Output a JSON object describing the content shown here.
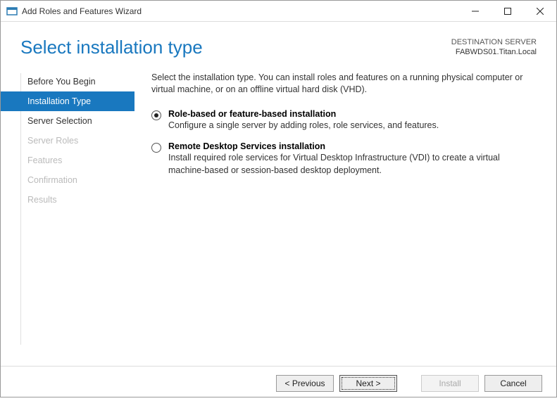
{
  "window": {
    "title": "Add Roles and Features Wizard"
  },
  "header": {
    "page_title": "Select installation type",
    "destination_label": "DESTINATION SERVER",
    "destination_value": "FABWDS01.Titan.Local"
  },
  "sidebar": {
    "items": [
      {
        "label": "Before You Begin",
        "state": "normal"
      },
      {
        "label": "Installation Type",
        "state": "active"
      },
      {
        "label": "Server Selection",
        "state": "normal"
      },
      {
        "label": "Server Roles",
        "state": "disabled"
      },
      {
        "label": "Features",
        "state": "disabled"
      },
      {
        "label": "Confirmation",
        "state": "disabled"
      },
      {
        "label": "Results",
        "state": "disabled"
      }
    ]
  },
  "content": {
    "intro": "Select the installation type. You can install roles and features on a running physical computer or virtual machine, or on an offline virtual hard disk (VHD).",
    "options": [
      {
        "title": "Role-based or feature-based installation",
        "desc": "Configure a single server by adding roles, role services, and features.",
        "selected": true
      },
      {
        "title": "Remote Desktop Services installation",
        "desc": "Install required role services for Virtual Desktop Infrastructure (VDI) to create a virtual machine-based or session-based desktop deployment.",
        "selected": false
      }
    ]
  },
  "footer": {
    "previous": "< Previous",
    "next": "Next >",
    "install": "Install",
    "cancel": "Cancel"
  }
}
